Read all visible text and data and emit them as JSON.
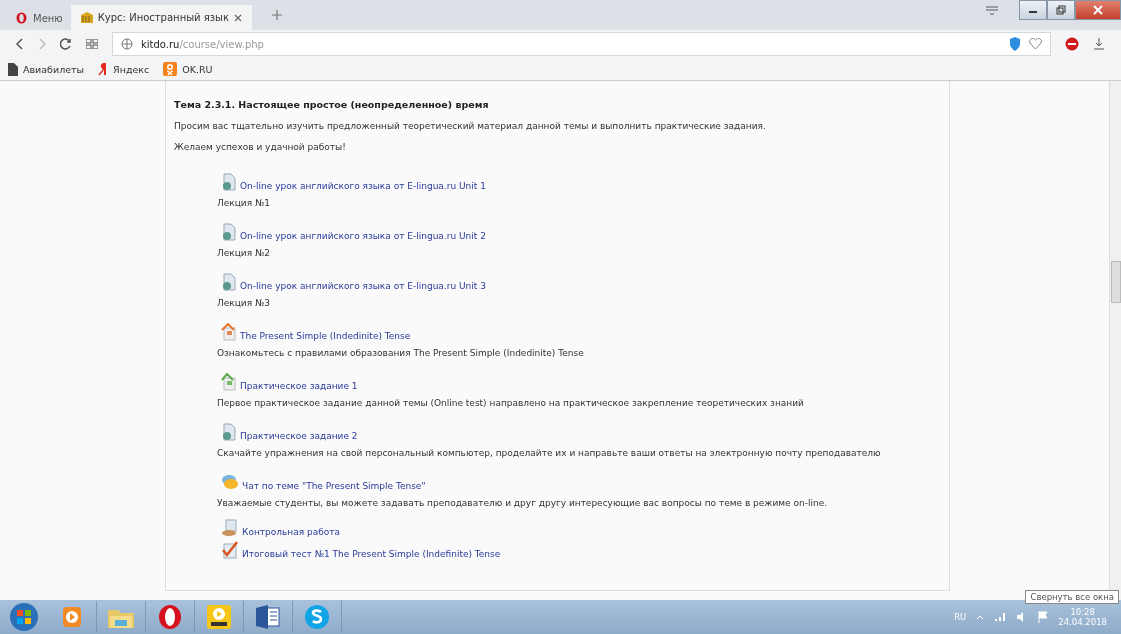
{
  "browser": {
    "menu_label": "Меню",
    "tabs": [
      {
        "title": "Курс: Иностранный язык",
        "selected": true
      }
    ],
    "address": {
      "host": "kitdo.ru",
      "path": "/course/view.php"
    },
    "bookmarks": [
      {
        "label": "Авиабилеты",
        "kind": "doc"
      },
      {
        "label": "Яндекс",
        "kind": "yandex"
      },
      {
        "label": "OK.RU",
        "kind": "ok"
      }
    ]
  },
  "topic": {
    "title": "Тема 2.3.1. Настоящее простое (неопределенное) время",
    "paragraphs": [
      "Просим вас тщательно изучить предложенный теоретический материал данной темы и выполнить практические задания.",
      "Желаем успехов и удачной работы!"
    ],
    "items": [
      {
        "kind": "page",
        "title": "On-line урок английского языка от E-lingua.ru Unit 1",
        "description": "Лекция №1"
      },
      {
        "kind": "page",
        "title": "On-line урок английского языка от E-lingua.ru Unit 2",
        "description": "Лекция №2"
      },
      {
        "kind": "page",
        "title": "On-line урок английского языка от E-lingua.ru Unit 3",
        "description": "Лекция №3"
      },
      {
        "kind": "html",
        "title": "The Present Simple (Indedinite) Tense",
        "description": "Ознакомьтесь с правилами образования The Present Simple (Indedinite) Tense"
      },
      {
        "kind": "quiz",
        "title": "Практическое задание 1",
        "description": "Первое практическое задание данной темы (Online test) направлено на практическое закрепление теоретических знаний"
      },
      {
        "kind": "file",
        "title": "Практическое задание 2",
        "description": "Скачайте упражнения на свой персональный компьютер, проделайте их и направьте ваши ответы на электронную почту преподавателю"
      },
      {
        "kind": "chat",
        "title": "Чат по теме \"The Present Simple Tense\"",
        "description": "Уважаемые студенты, вы можете задавать преподавателю и друг другу интересующие вас вопросы по теме в режиме on-line."
      },
      {
        "kind": "assignment",
        "title": "Контрольная работа"
      },
      {
        "kind": "test",
        "title": "Итоговый тест №1 The Present Simple (Indefinite) Tense"
      }
    ]
  },
  "taskbar": {
    "apps": [
      {
        "kind": "media"
      },
      {
        "kind": "explorer"
      },
      {
        "kind": "opera"
      },
      {
        "kind": "player"
      },
      {
        "kind": "word"
      },
      {
        "kind": "skype"
      }
    ],
    "language": "RU",
    "time": "10:28",
    "date": "24.04.2018",
    "tooltip": "Свернуть все окна"
  }
}
